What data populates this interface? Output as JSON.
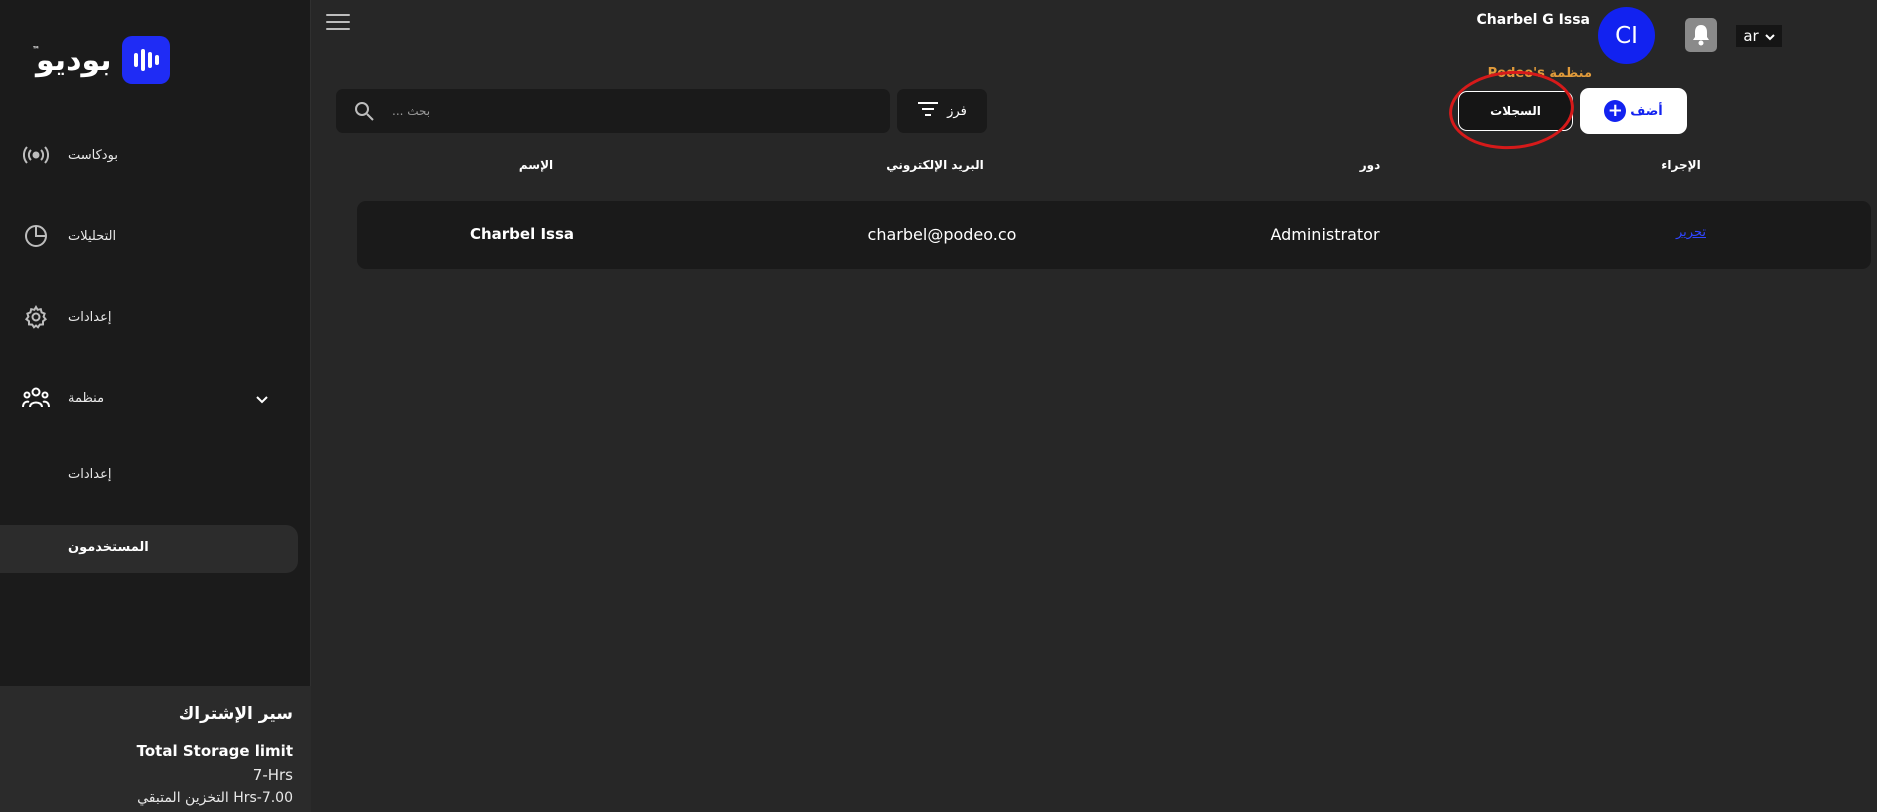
{
  "sidebar": {
    "logo_text": "بوديو",
    "logo_tm": "™",
    "items": [
      {
        "label": "بودكاست",
        "icon": "broadcast-icon"
      },
      {
        "label": "التحليلات",
        "icon": "pie-chart-icon"
      },
      {
        "label": "إعدادات",
        "icon": "gear-icon"
      },
      {
        "label": "منظمة",
        "icon": "group-icon"
      }
    ],
    "subitems": [
      {
        "label": "إعدادات"
      },
      {
        "label": "المستخدمون"
      }
    ],
    "subscription": {
      "title": "سير الإشتراك",
      "storage_label": "Total Storage limit",
      "hours": "7-Hrs",
      "remaining": "7.00-Hrs التخزين المتبقي"
    }
  },
  "header": {
    "user_name": "Charbel G Issa",
    "avatar_initials": "CI",
    "language": "ar",
    "org_label": "منظمة Podeo's"
  },
  "actions": {
    "add_label": "أضف",
    "records_label": "السجلات",
    "sort_label": "فرز",
    "search_placeholder": "بحث ..."
  },
  "table": {
    "headers": {
      "action": "الإجراء",
      "role": "دور",
      "email": "البريد الإلكتروني",
      "name": "الإسم"
    },
    "rows": [
      {
        "action": "تحرير",
        "role": "Administrator",
        "email": "charbel@podeo.co",
        "name": "Charbel Issa"
      }
    ]
  },
  "colors": {
    "accent": "#1222f0",
    "org_label": "#e09a3a",
    "highlight": "#d61a1a",
    "link": "#2f45ff"
  }
}
